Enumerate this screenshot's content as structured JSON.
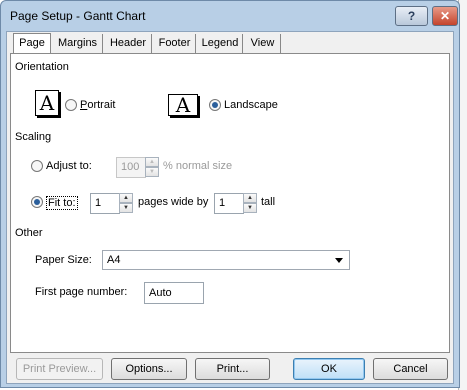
{
  "window": {
    "title": "Page Setup - Gantt Chart",
    "help_label": "?",
    "close_label": "✕"
  },
  "tabs": [
    "Page",
    "Margins",
    "Header",
    "Footer",
    "Legend",
    "View"
  ],
  "orientation": {
    "heading": "Orientation",
    "portrait_label": "Portrait",
    "landscape_label": "Landscape",
    "icon_glyph": "A",
    "selected": "landscape"
  },
  "scaling": {
    "heading": "Scaling",
    "adjust_label": "Adjust to:",
    "adjust_value": "100",
    "adjust_suffix": "% normal size",
    "fit_label": "Fit to:",
    "fit_wide_value": "1",
    "fit_wide_suffix": "pages wide by",
    "fit_tall_value": "1",
    "fit_tall_suffix": "tall",
    "selected": "fit"
  },
  "other": {
    "heading": "Other",
    "paper_size_label": "Paper Size:",
    "paper_size_value": "A4",
    "first_page_label": "First page number:",
    "first_page_value": "Auto"
  },
  "buttons": {
    "print_preview": "Print Preview...",
    "options": "Options...",
    "print": "Print...",
    "ok": "OK",
    "cancel": "Cancel"
  }
}
